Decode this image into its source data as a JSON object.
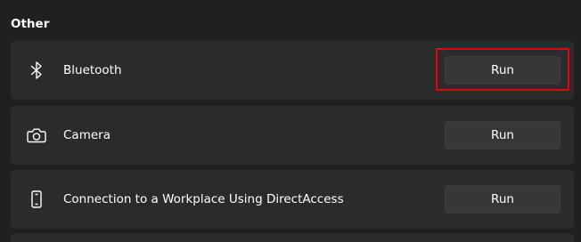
{
  "section": {
    "title": "Other"
  },
  "items": [
    {
      "label": "Bluetooth",
      "icon": "bluetooth-icon",
      "button_label": "Run"
    },
    {
      "label": "Camera",
      "icon": "camera-icon",
      "button_label": "Run"
    },
    {
      "label": "Connection to a Workplace Using DirectAccess",
      "icon": "phone-device-icon",
      "button_label": "Run"
    }
  ],
  "colors": {
    "background": "#202020",
    "card": "#2b2b2b",
    "button": "#373737",
    "highlight": "#e3000f",
    "text": "#ffffff"
  }
}
